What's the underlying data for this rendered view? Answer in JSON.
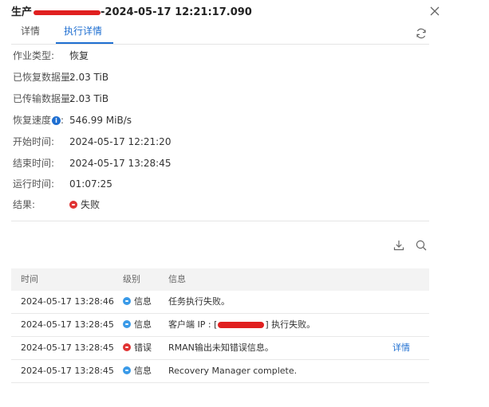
{
  "header": {
    "title_prefix": "生产",
    "title_suffix": "-2024-05-17 12:21:17.090"
  },
  "tabs": [
    {
      "label": "详情"
    },
    {
      "label": "执行详情"
    }
  ],
  "details": {
    "job_type": {
      "label": "作业类型:",
      "value": "恢复"
    },
    "restored": {
      "label": "已恢复数据量:",
      "value": "2.03 TiB"
    },
    "transferred": {
      "label": "已传输数据量:",
      "value": "2.03 TiB"
    },
    "speed": {
      "label_a": "恢复速度",
      "label_b": ":",
      "value": "546.99 MiB/s"
    },
    "start": {
      "label": "开始时间:",
      "value": "2024-05-17 12:21:20"
    },
    "end": {
      "label": "结束时间:",
      "value": "2024-05-17 13:28:45"
    },
    "duration": {
      "label": "运行时间:",
      "value": "01:07:25"
    },
    "result": {
      "label": "结果:",
      "value": "失败"
    }
  },
  "table": {
    "headers": [
      "时间",
      "级别",
      "信息"
    ],
    "rows": [
      {
        "time": "2024-05-17 13:28:46",
        "level": "信息",
        "level_color": "#3a9ae8",
        "msg": "任务执行失败。"
      },
      {
        "time": "2024-05-17 13:28:45",
        "level": "信息",
        "level_color": "#3a9ae8",
        "msg_a": "客户端 IP : [",
        "msg_b": "] 执行失败。"
      },
      {
        "time": "2024-05-17 13:28:45",
        "level": "错误",
        "level_color": "#e03333",
        "msg": "RMAN输出未知错误信息。",
        "action": "详情"
      },
      {
        "time": "2024-05-17 13:28:45",
        "level": "信息",
        "level_color": "#3a9ae8",
        "msg": "Recovery Manager complete."
      }
    ]
  },
  "colors": {
    "accent": "#1f6fd1",
    "error": "#e03333",
    "info": "#3a9ae8"
  }
}
